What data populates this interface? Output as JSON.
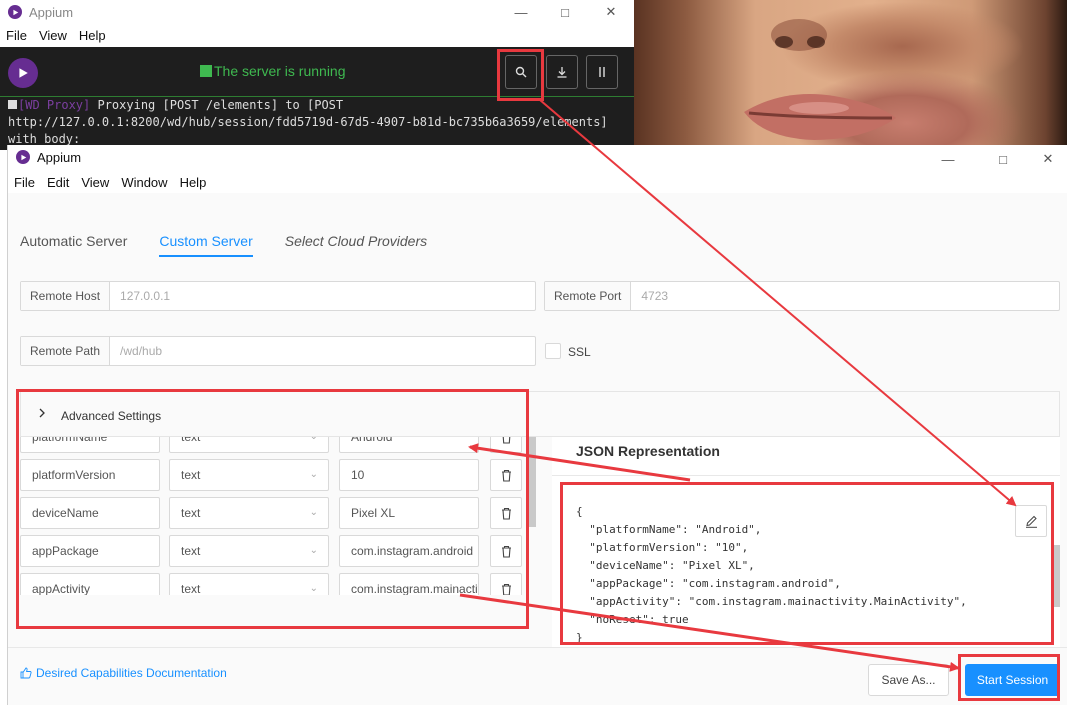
{
  "server_window": {
    "title": "Appium",
    "menu": [
      "File",
      "View",
      "Help"
    ],
    "status": "The server is running",
    "log_lines": [
      {
        "tag": "[WD Proxy]",
        "text": " Proxying [POST /elements] to [POST"
      },
      {
        "tag": "",
        "text": "http://127.0.0.1:8200/wd/hub/session/fdd5719d-67d5-4907-b81d-bc735b6a3659/elements]"
      },
      {
        "tag": "",
        "text": "with body:"
      }
    ]
  },
  "session_window": {
    "title": "Appium",
    "menu": [
      "File",
      "Edit",
      "View",
      "Window",
      "Help"
    ],
    "tabs": [
      "Automatic Server",
      "Custom Server",
      "Select Cloud Providers"
    ],
    "active_tab": "Custom Server",
    "remote_host": {
      "label": "Remote Host",
      "placeholder": "127.0.0.1"
    },
    "remote_port": {
      "label": "Remote Port",
      "placeholder": "4723"
    },
    "remote_path": {
      "label": "Remote Path",
      "placeholder": "/wd/hub"
    },
    "ssl_label": "SSL",
    "advanced_settings": "Advanced Settings",
    "capabilities": [
      {
        "name": "platformName",
        "type": "text",
        "value": "Android"
      },
      {
        "name": "platformVersion",
        "type": "text",
        "value": "10"
      },
      {
        "name": "deviceName",
        "type": "text",
        "value": "Pixel XL"
      },
      {
        "name": "appPackage",
        "type": "text",
        "value": "com.instagram.android"
      },
      {
        "name": "appActivity",
        "type": "text",
        "value": "com.instagram.mainactivity.MainActivity"
      }
    ],
    "json_title": "JSON Representation",
    "json_text": "{\n  \"platformName\": \"Android\",\n  \"platformVersion\": \"10\",\n  \"deviceName\": \"Pixel XL\",\n  \"appPackage\": \"com.instagram.android\",\n  \"appActivity\": \"com.instagram.mainactivity.MainActivity\",\n  \"noReset\": true\n}",
    "docs_link": "Desired Capabilities Documentation",
    "save_as": "Save As...",
    "start_session": "Start Session"
  },
  "colors": {
    "accent": "#1890ff",
    "annotation": "#e8393f",
    "status_green": "#3fb950",
    "appium_purple": "#662d91"
  }
}
